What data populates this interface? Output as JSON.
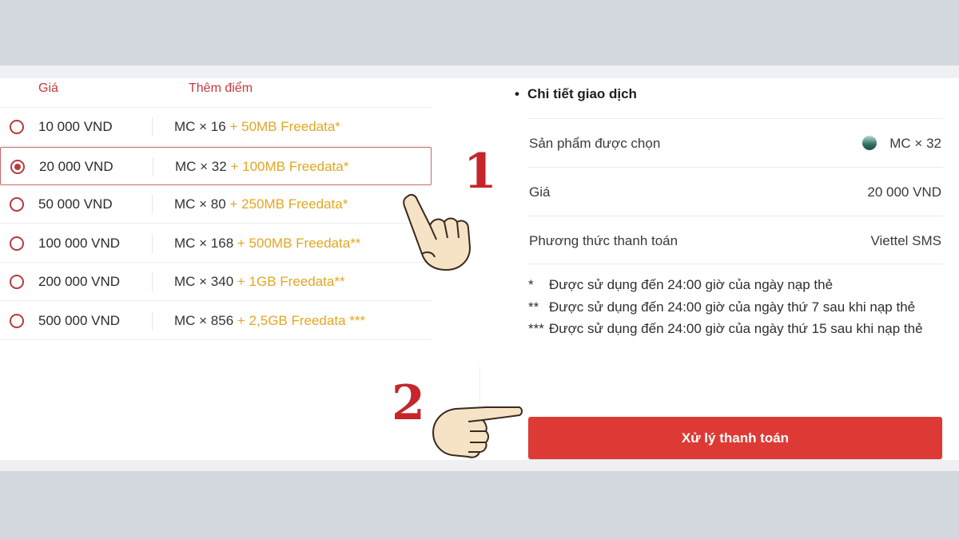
{
  "table": {
    "head_price": "Giá",
    "head_bonus": "Thêm điểm",
    "rows": [
      {
        "price": "10 000 VND",
        "bonus": "MC × 16",
        "extra": " + 50MB Freedata*",
        "selected": false
      },
      {
        "price": "20 000 VND",
        "bonus": "MC × 32",
        "extra": " + 100MB Freedata*",
        "selected": true
      },
      {
        "price": "50 000 VND",
        "bonus": "MC × 80",
        "extra": " + 250MB Freedata*",
        "selected": false
      },
      {
        "price": "100 000 VND",
        "bonus": "MC × 168",
        "extra": " + 500MB Freedata**",
        "selected": false
      },
      {
        "price": "200 000 VND",
        "bonus": "MC × 340",
        "extra": " + 1GB Freedata**",
        "selected": false
      },
      {
        "price": "500 000 VND",
        "bonus": "MC × 856",
        "extra": " + 2,5GB Freedata ***",
        "selected": false
      }
    ]
  },
  "annotations": {
    "step1": "1",
    "step2": "2"
  },
  "details": {
    "title": "Chi tiết giao dịch",
    "product_label": "Sản phẩm được chọn",
    "product_value": "MC × 32",
    "price_label": "Giá",
    "price_value": "20 000 VND",
    "method_label": "Phương thức thanh toán",
    "method_value": "Viettel SMS"
  },
  "notes": [
    {
      "mark": "*",
      "text": "Được sử dụng đến 24:00 giờ của ngày nạp thẻ"
    },
    {
      "mark": "**",
      "text": "Được sử dụng đến 24:00 giờ của ngày thứ 7 sau khi nạp thẻ"
    },
    {
      "mark": "***",
      "text": "Được sử dụng đến 24:00 giờ của ngày thứ 15 sau khi nạp thẻ"
    }
  ],
  "pay_button": "Xử lý thanh toán",
  "colors": {
    "accent_red": "#de3a35",
    "radio_red": "#b43b3f",
    "freedata_gold": "#e3a621"
  }
}
